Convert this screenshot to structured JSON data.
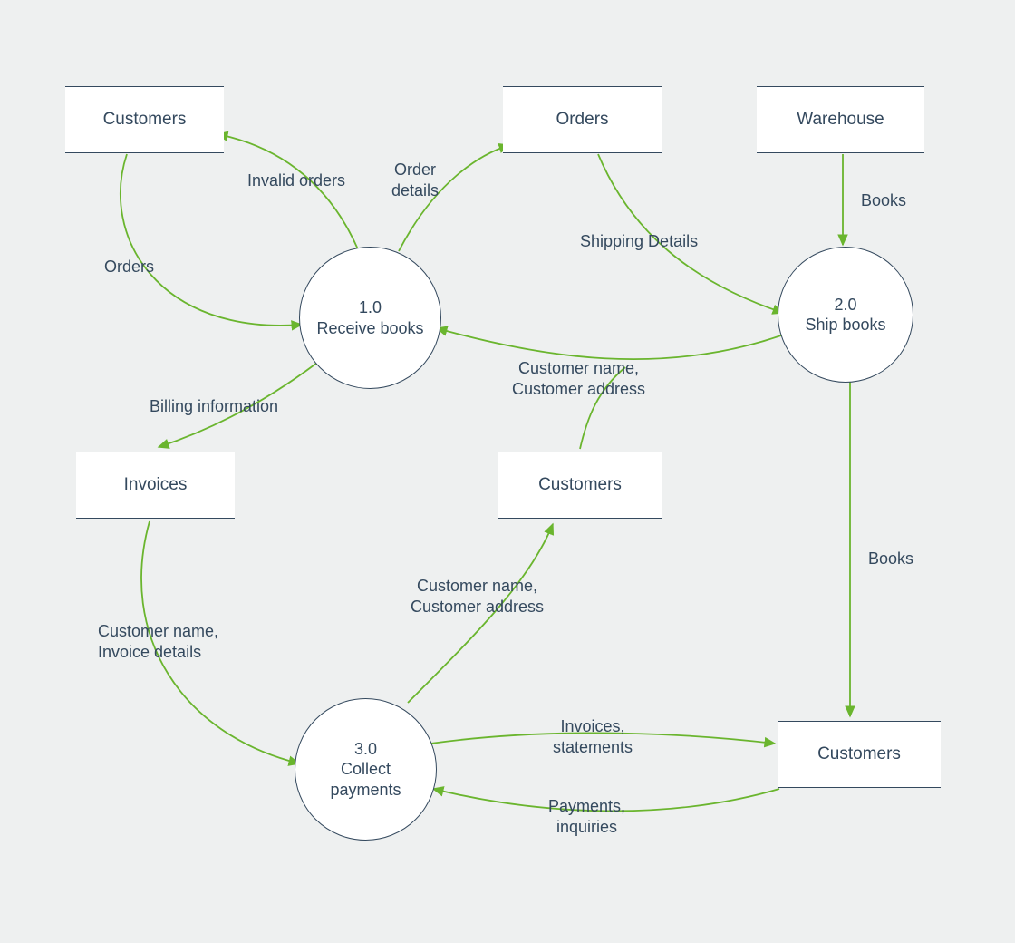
{
  "entities": {
    "customers_top": "Customers",
    "orders": "Orders",
    "warehouse": "Warehouse",
    "invoices": "Invoices",
    "customers_mid": "Customers",
    "customers_bottom": "Customers"
  },
  "processes": {
    "p1": {
      "num": "1.0",
      "name": "Receive books"
    },
    "p2": {
      "num": "2.0",
      "name": "Ship books"
    },
    "p3": {
      "num": "3.0",
      "name": "Collect\npayments"
    }
  },
  "flows": {
    "orders_from_customers": "Orders",
    "invalid_orders": "Invalid orders",
    "order_details": "Order\ndetails",
    "shipping_details": "Shipping Details",
    "books_wh": "Books",
    "customer_info_p1": "Customer name,\nCustomer address",
    "billing_information": "Billing information",
    "books_ship": "Books",
    "invoice_details": "Customer name,\nInvoice details",
    "customer_info_p3": "Customer name,\nCustomer address",
    "invoices_statements": "Invoices,\nstatements",
    "payments_inquiries": "Payments,\ninquiries"
  },
  "colors": {
    "arrow": "#6ab52e",
    "text": "#34495e",
    "bg": "#eef0f0"
  }
}
